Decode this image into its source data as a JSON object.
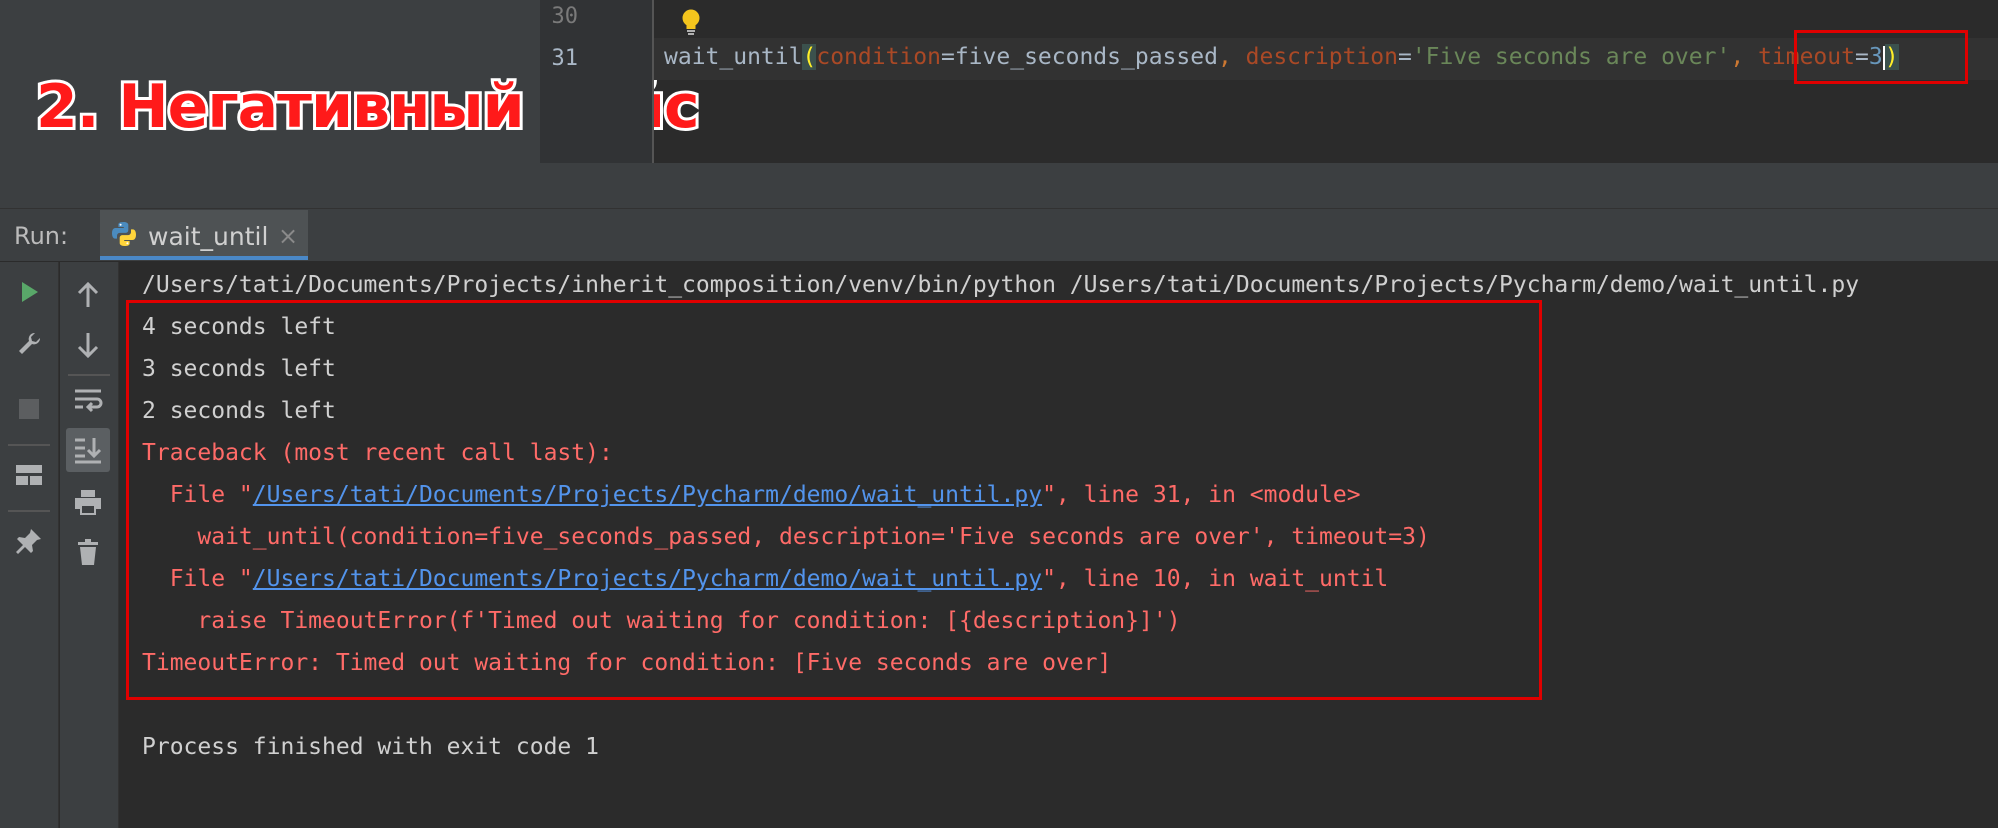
{
  "annotation": {
    "title": "2. Негативный кейс"
  },
  "editor": {
    "line_numbers": [
      "30",
      "31"
    ],
    "code": {
      "func": "wait_until",
      "open_paren": "(",
      "p1_name": "condition",
      "eq1": "=",
      "p1_value": "five_seconds_passed",
      "sep1": ", ",
      "p2_name": "description",
      "eq2": "=",
      "p2_value": "'Five seconds are over'",
      "sep2": ", ",
      "p3_name": "timeout",
      "eq3": "=",
      "p3_value": "3",
      "close_paren": ")"
    }
  },
  "run": {
    "label": "Run:",
    "tab_label": "wait_until",
    "tab_close": "×"
  },
  "console": {
    "command": "/Users/tati/Documents/Projects/inherit_composition/venv/bin/python /Users/tati/Documents/Projects/Pycharm/demo/wait_until.py",
    "lines": [
      "4 seconds left",
      "3 seconds left",
      "2 seconds left"
    ],
    "traceback_header": "Traceback (most recent call last):",
    "frame1_prefix": "  File \"",
    "frame1_path": "/Users/tati/Documents/Projects/Pycharm/demo/wait_until.py",
    "frame1_suffix": "\", line 31, in <module>",
    "frame1_code": "    wait_until(condition=five_seconds_passed, description='Five seconds are over', timeout=3)",
    "frame2_prefix": "  File \"",
    "frame2_path": "/Users/tati/Documents/Projects/Pycharm/demo/wait_until.py",
    "frame2_suffix": "\", line 10, in wait_until",
    "frame2_code": "    raise TimeoutError(f'Timed out waiting for condition: [{description}]')",
    "error": "TimeoutError: Timed out waiting for condition: [Five seconds are over]",
    "exit": "Process finished with exit code 1"
  },
  "icons": {
    "bulb": "lightbulb-icon",
    "python": "python-icon",
    "run": "play-icon",
    "wrench": "wrench-icon",
    "stop": "stop-icon",
    "layout": "layout-icon",
    "pin": "pin-icon",
    "up": "arrow-up-icon",
    "down": "arrow-down-icon",
    "wrap": "soft-wrap-icon",
    "scroll": "scroll-to-end-icon",
    "print": "print-icon",
    "trash": "trash-icon"
  },
  "colors": {
    "highlight": "#e00000",
    "error_text": "#ff6b68",
    "link": "#5394ec"
  }
}
